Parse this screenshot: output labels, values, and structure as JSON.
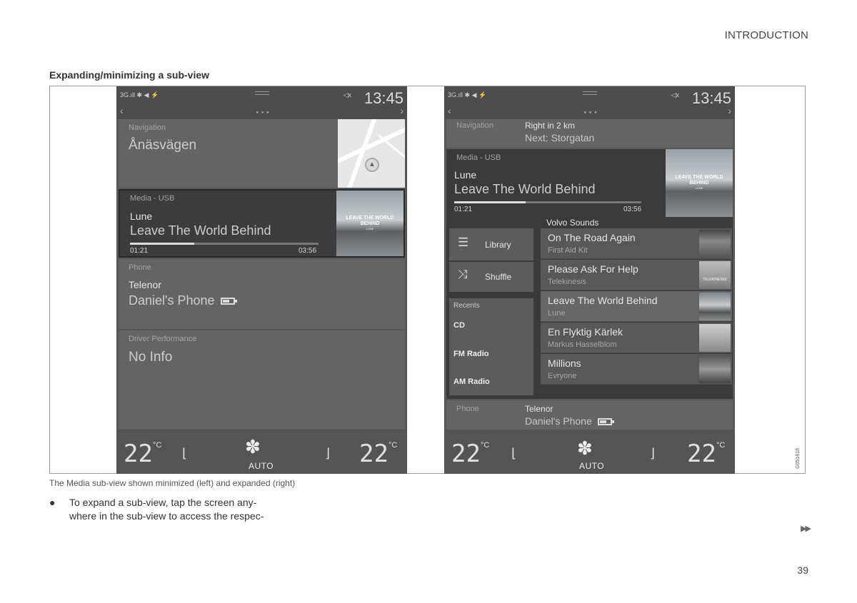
{
  "header": {
    "chapter": "INTRODUCTION"
  },
  "section_title": "Expanding/minimizing a sub-view",
  "caption": "The Media sub-view shown minimized (left) and expanded (right)",
  "bullet": {
    "symbol": "●",
    "text": "To expand a sub-view, tap the screen any-where in the sub-view to access the respec-"
  },
  "bullet_lines": [
    "To expand a sub-view, tap the screen any-",
    "where in the sub-view to access the respec-"
  ],
  "continue_marker": "▶▶",
  "page_number": "39",
  "figure_id": "G051818",
  "status_bar": {
    "left": "3G.ıll ✱ ◀ ⚡",
    "time": "13:45",
    "volume": "◁x"
  },
  "left_screen": {
    "navigation": {
      "header": "Navigation",
      "street": "Ånäsvägen"
    },
    "media": {
      "header": "Media - USB",
      "artist": "Lune",
      "title": "Leave The World Behind",
      "elapsed": "01:21",
      "total": "03:56",
      "progress": 0.34,
      "art_title": "LEAVE THE WORLD BEHIND",
      "art_sub": "LUNE"
    },
    "phone": {
      "header": "Phone",
      "carrier": "Telenor",
      "device": "Daniel's Phone"
    },
    "driver": {
      "header": "Driver Performance",
      "value": "No Info"
    }
  },
  "right_screen": {
    "navigation": {
      "header": "Navigation",
      "instruction": "Right in 2 km",
      "next": "Next: Storgatan"
    },
    "media": {
      "header": "Media - USB",
      "artist": "Lune",
      "title": "Leave The World Behind",
      "elapsed": "01:21",
      "total": "03:56",
      "progress": 0.38,
      "art_title": "LEAVE THE WORLD BEHIND",
      "art_sub": "LUNE"
    },
    "library_label": "Library",
    "shuffle_label": "Shuffle",
    "recents": {
      "header": "Recents",
      "items": [
        "CD",
        "FM Radio",
        "AM Radio"
      ]
    },
    "playlist": {
      "name": "Volvo Sounds",
      "tracks": [
        {
          "title": "On The Road Again",
          "artist": "First Aid Kit"
        },
        {
          "title": "Please Ask For Help",
          "artist": "Telekinesis",
          "thumb_label": "TELEKINESIS!"
        },
        {
          "title": "Leave The World Behind",
          "artist": "Lune"
        },
        {
          "title": "En Flyktig Kärlek",
          "artist": "Markus Hasselblom"
        },
        {
          "title": "Millions",
          "artist": "Evryone"
        }
      ]
    },
    "phone": {
      "header": "Phone",
      "carrier": "Telenor",
      "device": "Daniel's Phone"
    }
  },
  "climate": {
    "left_temp": "22",
    "right_temp": "22",
    "unit": "°C",
    "auto": "AUTO"
  },
  "icons": [
    "seat-heat-icon",
    "fan-icon",
    "shuffle-icon",
    "library-icon",
    "battery-icon",
    "chevron-left-icon",
    "chevron-right-icon"
  ]
}
